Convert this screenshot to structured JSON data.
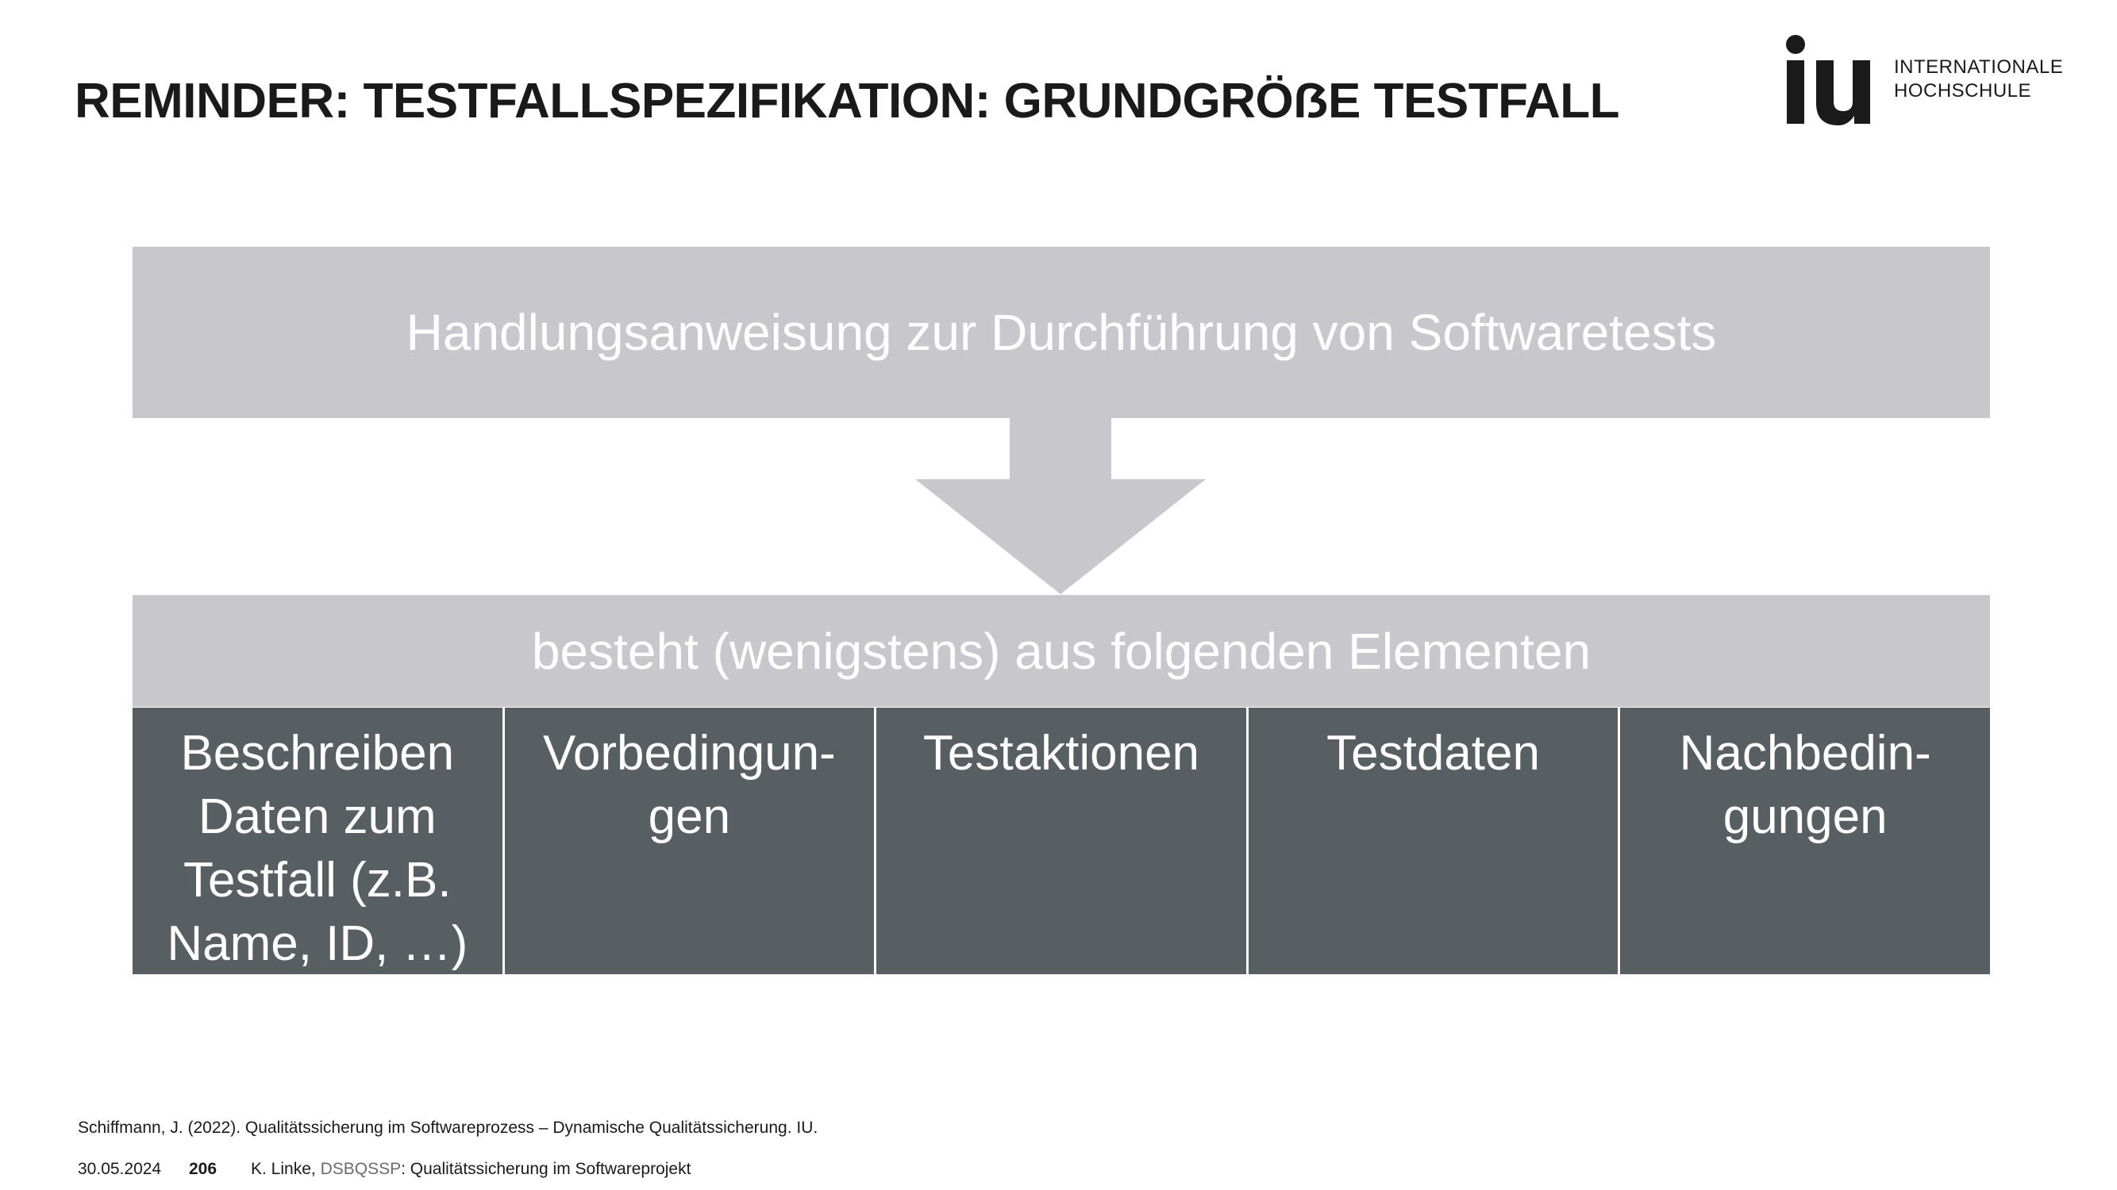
{
  "slide": {
    "title": "REMINDER: TESTFALLSPEZIFIKATION: GRUNDGRÖẞE TESTFALL"
  },
  "logo": {
    "mark": "iu",
    "line1": "INTERNATIONALE",
    "line2": "HOCHSCHULE"
  },
  "diagram": {
    "top_box": "Handlungsanweisung zur Durchführung von Softwaretests",
    "middle_box": "besteht (wenigstens) aus folgenden Elementen",
    "elements": [
      "Beschreiben\nDaten zum\nTestfall (z.B.\nName, ID, …)",
      "Vorbedingun-\ngen",
      "Testaktionen",
      "Testdaten",
      "Nachbedin-\ngungen"
    ],
    "colors": {
      "light_box": "#c8c8cc",
      "dark_cell": "#585f63",
      "text_on_box": "#ffffff"
    }
  },
  "footer": {
    "source": "Schiffmann, J. (2022). Qualitätssicherung im Softwareprozess – Dynamische Qualitätssicherung. IU.",
    "date": "30.05.2024",
    "page": "206",
    "author": "K. Linke, ",
    "course_code": "DSBQSSP",
    "course_title": ": Qualitätssicherung im Softwareprojekt"
  }
}
